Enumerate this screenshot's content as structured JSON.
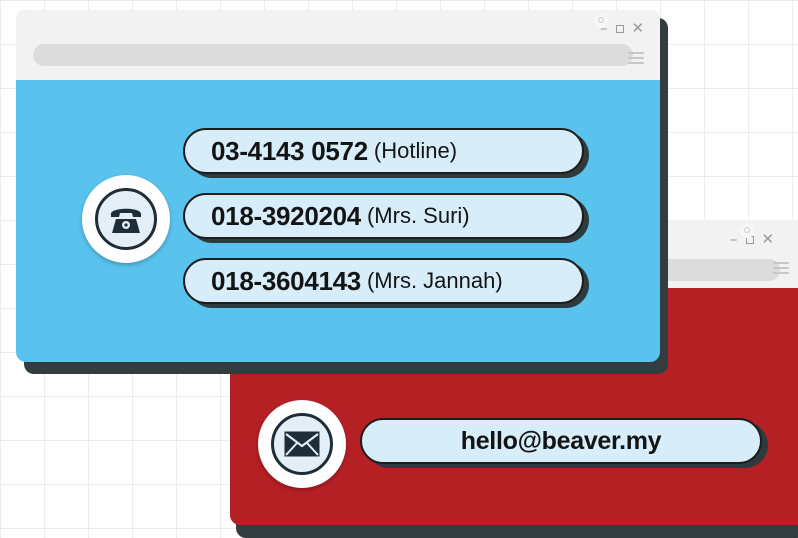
{
  "phone_window": {
    "controls": {
      "minimize": "–",
      "close": "✕"
    },
    "icon": "telephone-icon",
    "rows": [
      {
        "number": "03-4143 0572",
        "label": "(Hotline)"
      },
      {
        "number": "018-3920204",
        "label": "(Mrs. Suri)"
      },
      {
        "number": "018-3604143",
        "label": "(Mrs. Jannah)"
      }
    ]
  },
  "email_window": {
    "controls": {
      "minimize": "–",
      "close": "✕"
    },
    "icon": "envelope-icon",
    "email": "hello@beaver.my"
  },
  "colors": {
    "blue_window": "#59c3ee",
    "red_window": "#b52025",
    "pill_fill": "#d7edf9",
    "titlebar": "#f2f2f2"
  }
}
